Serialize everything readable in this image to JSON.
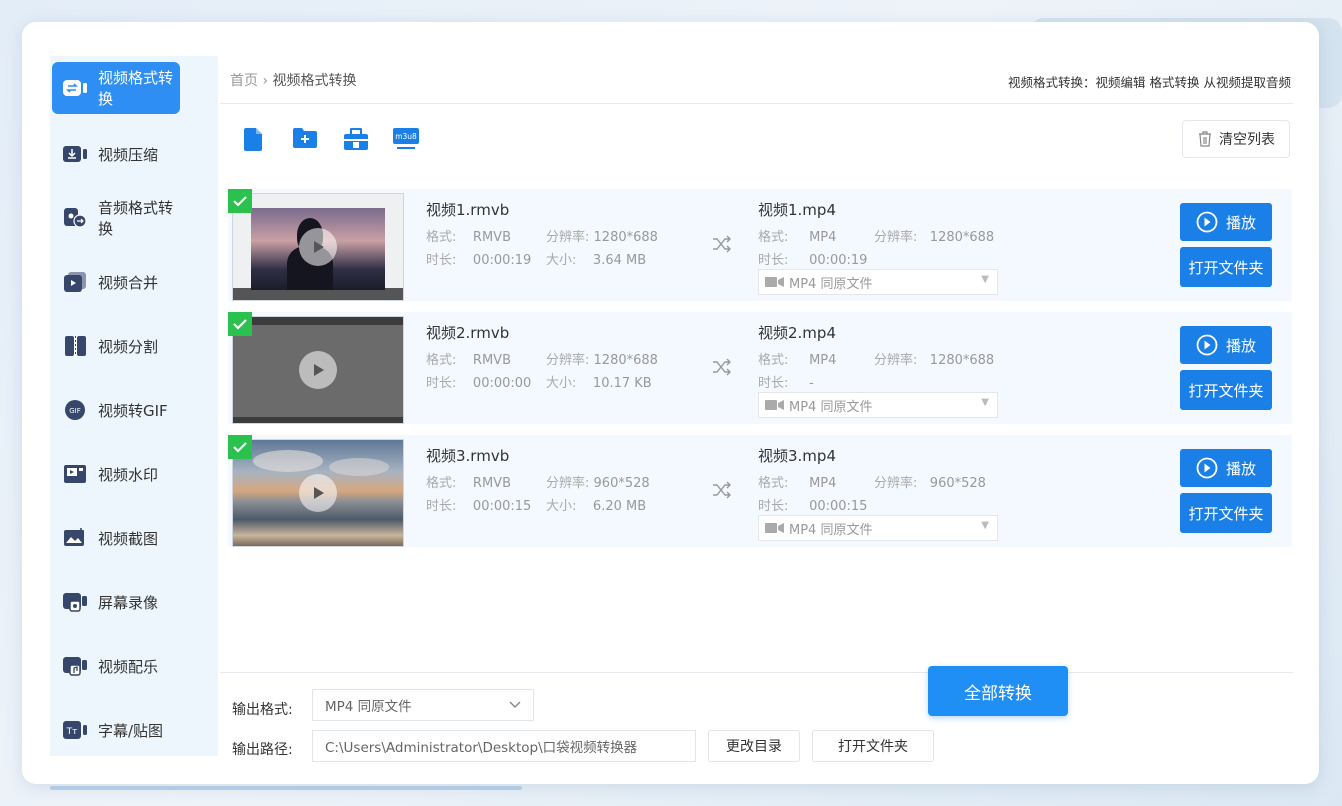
{
  "sidebar": {
    "items": [
      {
        "label": "视频格式转换",
        "icon": "convert-icon",
        "active": true
      },
      {
        "label": "视频压缩",
        "icon": "compress-icon",
        "active": false
      },
      {
        "label": "音频格式转换",
        "icon": "audio-convert-icon",
        "active": false
      },
      {
        "label": "视频合并",
        "icon": "merge-icon",
        "active": false
      },
      {
        "label": "视频分割",
        "icon": "split-icon",
        "active": false
      },
      {
        "label": "视频转GIF",
        "icon": "gif-icon",
        "active": false
      },
      {
        "label": "视频水印",
        "icon": "watermark-icon",
        "active": false
      },
      {
        "label": "视频截图",
        "icon": "screenshot-icon",
        "active": false
      },
      {
        "label": "屏幕录像",
        "icon": "screen-record-icon",
        "active": false
      },
      {
        "label": "视频配乐",
        "icon": "music-icon",
        "active": false
      },
      {
        "label": "字幕/贴图",
        "icon": "subtitle-icon",
        "active": false
      }
    ]
  },
  "breadcrumb": {
    "home": "首页",
    "separator": "›",
    "current": "视频格式转换"
  },
  "header_features": "视频格式转换：视频编辑 格式转换 从视频提取音频",
  "toolbar": {
    "clear_label": "清空列表",
    "m3u8_label": "m3u8"
  },
  "files": [
    {
      "src_name": "视频1.rmvb",
      "src_format": "RMVB",
      "src_resolution": "1280*688",
      "src_duration": "00:00:19",
      "src_size": "3.64 MB",
      "dst_name": "视频1.mp4",
      "dst_format": "MP4",
      "dst_resolution": "1280*688",
      "dst_duration": "00:00:19"
    },
    {
      "src_name": "视频2.rmvb",
      "src_format": "RMVB",
      "src_resolution": "1280*688",
      "src_duration": "00:00:00",
      "src_size": "10.17 KB",
      "dst_name": "视频2.mp4",
      "dst_format": "MP4",
      "dst_resolution": "1280*688",
      "dst_duration": "-"
    },
    {
      "src_name": "视频3.rmvb",
      "src_format": "RMVB",
      "src_resolution": "960*528",
      "src_duration": "00:00:15",
      "src_size": "6.20 MB",
      "dst_name": "视频3.mp4",
      "dst_format": "MP4",
      "dst_resolution": "960*528",
      "dst_duration": "00:00:15"
    }
  ],
  "labels": {
    "format": "格式:",
    "resolution": "分辨率:",
    "duration": "时长:",
    "size": "大小:",
    "output_option": "MP4  同原文件",
    "play": "播放",
    "open_folder": "打开文件夹"
  },
  "bottom": {
    "output_format_label": "输出格式:",
    "output_format_value": "MP4  同原文件",
    "output_path_label": "输出路径:",
    "output_path_value": "C:\\Users\\Administrator\\Desktop\\口袋视频转换器",
    "change_dir_label": "更改目录",
    "open_folder_label": "打开文件夹",
    "convert_all_label": "全部转换"
  },
  "colors": {
    "accent": "#1b7fe8",
    "sidebar_bg": "#eef6fd",
    "row_bg": "#f3f9fe",
    "check": "#2bc14e"
  }
}
